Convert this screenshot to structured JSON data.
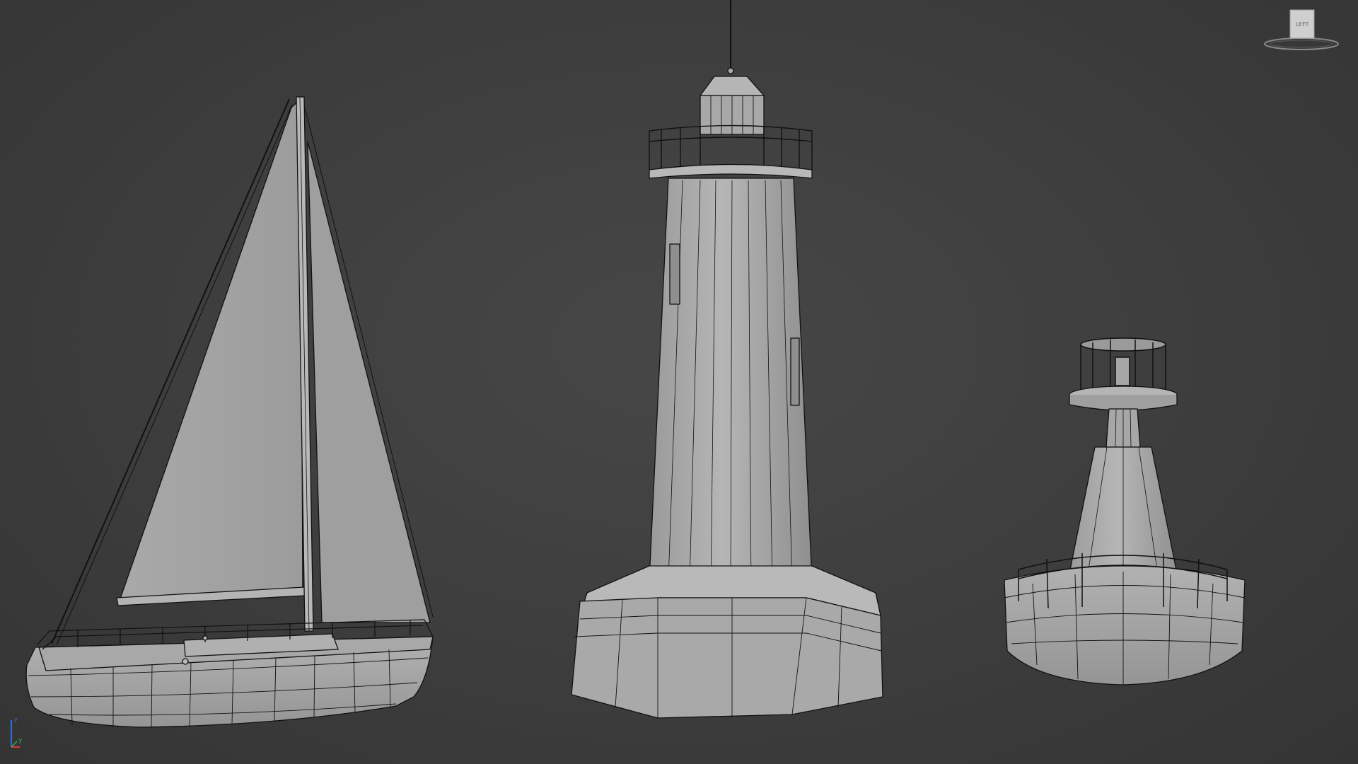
{
  "viewport": {
    "background": "#3f3f3f",
    "wire_color": "#111111",
    "surface_color": "#a6a6a6",
    "surface_light": "#bdbdbd",
    "surface_dark": "#8c8c8c"
  },
  "viewcube": {
    "face_label": "LEFT"
  },
  "axis": {
    "z_label": "z",
    "y_label": "y",
    "z_color": "#2f6fd6",
    "y_color": "#2fb34a",
    "x_color": "#d63a3a"
  }
}
